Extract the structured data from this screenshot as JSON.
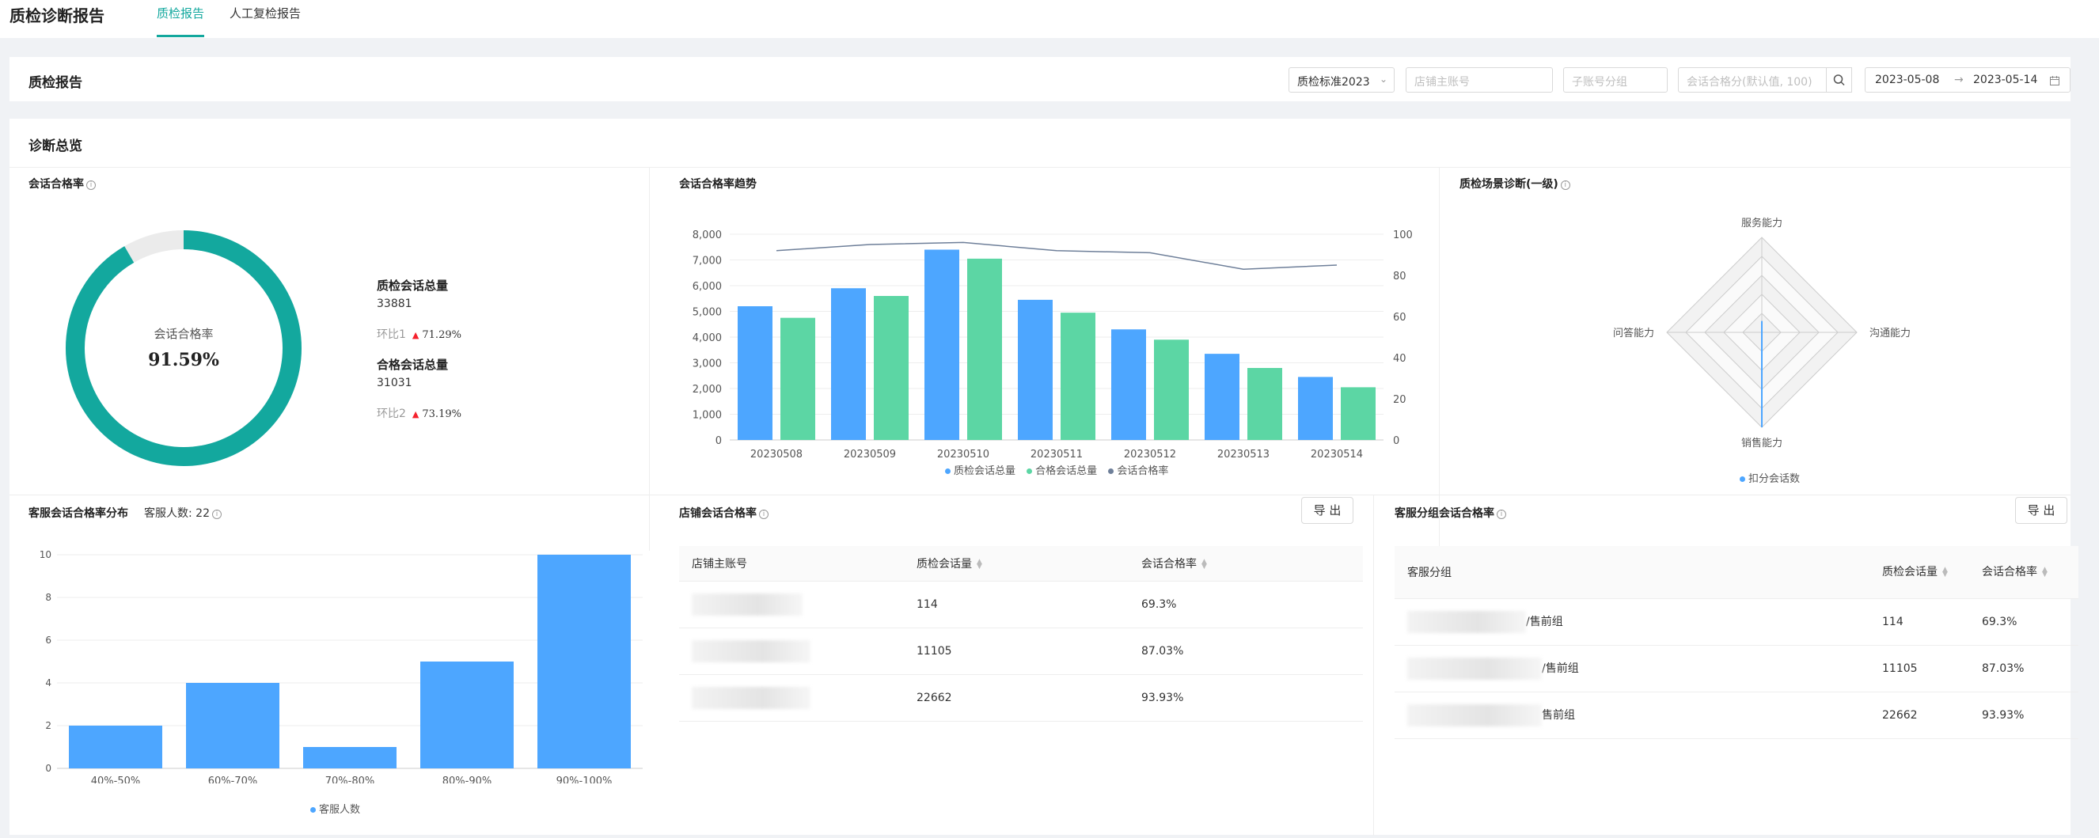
{
  "app": {
    "title": "质检诊断报告",
    "tabs": [
      {
        "label": "质检报告",
        "active": true
      },
      {
        "label": "人工复检报告",
        "active": false
      }
    ],
    "accent_color": "#13a89e"
  },
  "filters": {
    "title": "质检报告",
    "standard": "质检标准2023",
    "store_account_placeholder": "店铺主账号",
    "sub_group_placeholder": "子账号分组",
    "score_placeholder": "会话合格分(默认值, 100)",
    "date_start": "2023-05-08",
    "date_end": "2023-05-14"
  },
  "overview": {
    "title": "诊断总览",
    "donut": {
      "title": "会话合格率",
      "center_label": "会话合格率",
      "center_value": "91.59%",
      "rate": 0.9159,
      "color": "#13a89e",
      "track_color": "#ebebeb"
    },
    "stats": [
      {
        "label": "质检会话总量",
        "value": "33881",
        "ratio_label": "环比1",
        "ratio_value": "71.29%"
      },
      {
        "label": "合格会话总量",
        "value": "31031",
        "ratio_label": "环比2",
        "ratio_value": "73.19%"
      }
    ]
  },
  "trend": {
    "title": "会话合格率趋势",
    "legend": [
      {
        "name": "质检会话总量",
        "color": "#4da6ff"
      },
      {
        "name": "合格会话总量",
        "color": "#5cd6a4"
      },
      {
        "name": "会话合格率",
        "color": "#6e7f99"
      }
    ]
  },
  "radar": {
    "title": "质检场景诊断(一级)",
    "legend": "扣分会话数",
    "color": "#4da6ff"
  },
  "distribution": {
    "title": "客服会话合格率分布",
    "people_label": "客服人数: 22",
    "legend": "客服人数",
    "color": "#4da6ff"
  },
  "store_table": {
    "title": "店铺会话合格率",
    "export_label": "导 出",
    "columns": [
      "店铺主账号",
      "质检会话量",
      "会话合格率"
    ],
    "rows": [
      {
        "count": "114",
        "rate": "69.3%"
      },
      {
        "count": "11105",
        "rate": "87.03%"
      },
      {
        "count": "22662",
        "rate": "93.93%"
      }
    ]
  },
  "group_table": {
    "title": "客服分组会话合格率",
    "export_label": "导 出",
    "columns": [
      "客服分组",
      "质检会话量",
      "会话合格率"
    ],
    "rows": [
      {
        "group": "/售前组",
        "count": "114",
        "rate": "69.3%"
      },
      {
        "group": "/售前组",
        "count": "11105",
        "rate": "87.03%"
      },
      {
        "group": "售前组",
        "count": "22662",
        "rate": "93.93%"
      }
    ]
  },
  "chart_data": [
    {
      "type": "bar",
      "title": "会话合格率趋势",
      "categories": [
        "20230508",
        "20230509",
        "20230510",
        "20230511",
        "20230512",
        "20230513",
        "20230514"
      ],
      "series": [
        {
          "name": "质检会话总量",
          "type": "bar",
          "axis": "left",
          "values": [
            5200,
            5900,
            7400,
            5450,
            4300,
            3350,
            2450
          ]
        },
        {
          "name": "合格会话总量",
          "type": "bar",
          "axis": "left",
          "values": [
            4750,
            5600,
            7050,
            4950,
            3900,
            2800,
            2050
          ]
        },
        {
          "name": "会话合格率",
          "type": "line",
          "axis": "right",
          "values": [
            92,
            95,
            96,
            92,
            91,
            83,
            85
          ]
        }
      ],
      "ylim_left": [
        0,
        8000
      ],
      "yticks_left": [
        "0",
        "1,000",
        "2,000",
        "3,000",
        "4,000",
        "5,000",
        "6,000",
        "7,000",
        "8,000"
      ],
      "ylim_right": [
        0,
        100
      ],
      "yticks_right": [
        "0",
        "20",
        "40",
        "60",
        "80",
        "100"
      ],
      "grid": true,
      "legend_position": "bottom"
    },
    {
      "type": "radar",
      "title": "质检场景诊断(一级)",
      "indicators": [
        "服务能力",
        "沟通能力",
        "销售能力",
        "问答能力"
      ],
      "series": [
        {
          "name": "扣分会话数",
          "values": [
            0.12,
            0.0,
            1.0,
            0.0
          ]
        }
      ],
      "legend_position": "bottom"
    },
    {
      "type": "bar",
      "title": "客服会话合格率分布",
      "categories": [
        "40%-50%",
        "60%-70%",
        "70%-80%",
        "80%-90%",
        "90%-100%"
      ],
      "series": [
        {
          "name": "客服人数",
          "values": [
            2,
            4,
            1,
            5,
            10
          ]
        }
      ],
      "ylim": [
        0,
        10
      ],
      "yticks": [
        "0",
        "2",
        "4",
        "6",
        "8",
        "10"
      ],
      "grid": true,
      "legend_position": "bottom"
    }
  ]
}
